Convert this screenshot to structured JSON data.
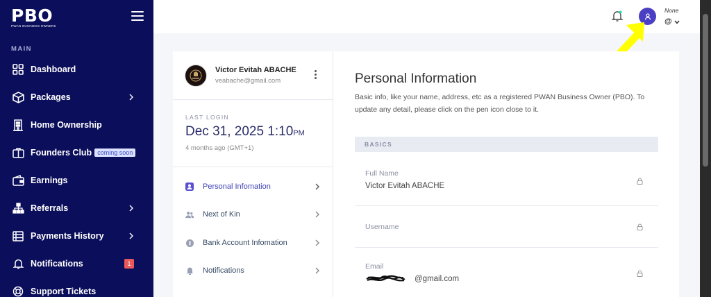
{
  "sidebar": {
    "logo_text": "PBO",
    "logo_subtitle": "PWAN BUSINESS OWNERS",
    "section_label": "MAIN",
    "items": [
      {
        "label": "Dashboard",
        "icon": "dashboard-icon",
        "chevron": false
      },
      {
        "label": "Packages",
        "icon": "package-icon",
        "chevron": true
      },
      {
        "label": "Home Ownership",
        "icon": "building-icon",
        "chevron": false
      },
      {
        "label": "Founders Club",
        "icon": "briefcase-icon",
        "chevron": false,
        "badge": "coming soon"
      },
      {
        "label": "Earnings",
        "icon": "wallet-icon",
        "chevron": false
      },
      {
        "label": "Referrals",
        "icon": "hierarchy-icon",
        "chevron": true
      },
      {
        "label": "Payments History",
        "icon": "list-icon",
        "chevron": true
      },
      {
        "label": "Notifications",
        "icon": "bell-icon",
        "chevron": false,
        "count": "1"
      },
      {
        "label": "Support Tickets",
        "icon": "lifebuoy-icon",
        "chevron": false
      }
    ]
  },
  "topbar": {
    "user_name": "None",
    "user_handle": "@",
    "colors": {
      "avatar": "#4b3fc4",
      "annotation_arrow": "#ffff00"
    }
  },
  "profile": {
    "name": "Victor Evitah ABACHE",
    "email": "veabache@gmail.com"
  },
  "last_login": {
    "label": "LAST LOGIN",
    "date": "Dec 31, 2025 1:10",
    "meridiem": "PM",
    "ago": "4 months ago (GMT+1)"
  },
  "profile_menu": [
    {
      "label": "Personal Infomation",
      "icon": "user-card-icon",
      "active": true
    },
    {
      "label": "Next of Kin",
      "icon": "users-icon",
      "active": false
    },
    {
      "label": "Bank Account Infomation",
      "icon": "bank-icon",
      "active": false
    },
    {
      "label": "Notifications",
      "icon": "bell-icon",
      "active": false
    }
  ],
  "personal_info": {
    "title": "Personal Information",
    "description": "Basic info, like your name, address, etc as a registered PWAN Business Owner (PBO). To update any detail, please click on the pen icon close to it.",
    "section": "BASICS",
    "fields": [
      {
        "label": "Full Name",
        "value": "Victor Evitah ABACHE"
      },
      {
        "label": "Username",
        "value": ""
      },
      {
        "label": "Email",
        "value": "@gmail.com"
      }
    ]
  },
  "colors": {
    "sidebar": "#0b0e5a",
    "accent": "#2a2d6a",
    "badge_red": "#e85a5a"
  }
}
